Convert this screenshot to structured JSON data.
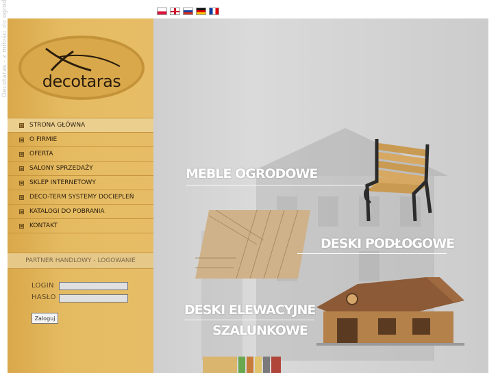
{
  "flags": [
    {
      "name": "flag-polish",
      "css": "flag-pl"
    },
    {
      "name": "flag-english",
      "css": "flag-en"
    },
    {
      "name": "flag-russian",
      "css": "flag-ru"
    },
    {
      "name": "flag-german",
      "css": "flag-de"
    },
    {
      "name": "flag-french",
      "css": "flag-fr"
    }
  ],
  "tagline": "Decotaras - z miłości do ogrodu",
  "logo": {
    "text": "decotaras"
  },
  "nav": {
    "items": [
      {
        "label": "STRONA GŁÓWNA",
        "active": true
      },
      {
        "label": "O FIRMIE"
      },
      {
        "label": "OFERTA"
      },
      {
        "label": "SALONY SPRZEDAŻY"
      },
      {
        "label": "SKLEP INTERNETOWY"
      },
      {
        "label": "DECO-TERM SYSTEMY DOCIEPLEŃ"
      },
      {
        "label": "KATALOGI DO POBRANIA"
      },
      {
        "label": "KONTAKT"
      }
    ]
  },
  "partner": {
    "label": "PARTNER HANDLOWY - LOGOWANIE"
  },
  "login": {
    "login_label": "LOGIN",
    "password_label": "HASŁO",
    "login_value": "",
    "password_value": "",
    "submit_label": "Zaloguj"
  },
  "hero": {
    "meble": "MEBLE OGRODOWE",
    "deski": "DESKI PODŁOGOWE",
    "elewacyjne": "DESKI ELEWACYJNE",
    "szalunkowe": "SZALUNKOWE"
  },
  "colors": {
    "sidebar": "#e5bb62",
    "sidebar_border": "#c8963c",
    "hero_bg": "#d4d4d4",
    "text_dark": "#2a1d0e"
  }
}
